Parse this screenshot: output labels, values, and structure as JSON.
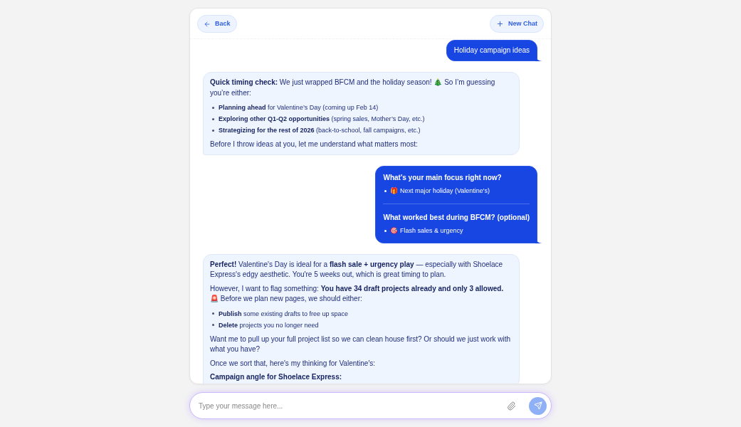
{
  "header": {
    "back_label": "Back",
    "new_chat_label": "New Chat"
  },
  "messages": [
    {
      "kind": "prompt",
      "text": "Holiday campaign ideas"
    },
    {
      "kind": "reply",
      "blocks": [
        {
          "kind": "paragraph",
          "text": "**Quick timing check:** We just wrapped BFCM and the holiday season! 🎄 So I’m guessing you’re either:"
        },
        {
          "kind": "list",
          "items": [
            "**Planning ahead** for Valentine’s Day (coming up Feb 14)",
            "**Exploring other Q1-Q2 opportunities** (spring sales, Mother’s Day, etc.)",
            "**Strategizing for the rest of 2026** (back-to-school, fall campaigns, etc.)"
          ]
        },
        {
          "kind": "paragraph",
          "text": "Before I throw ideas at you, let me understand what matters most:"
        }
      ]
    },
    {
      "kind": "answers",
      "answers": [
        {
          "question": "What's your main focus right now?",
          "choices": [
            "🎁 Next major holiday (Valentine's)"
          ]
        },
        {
          "question": "What worked best during BFCM? (optional)",
          "choices": [
            "🎯 Flash sales & urgency"
          ]
        }
      ]
    },
    {
      "kind": "reply",
      "blocks": [
        {
          "kind": "paragraph",
          "text": "**Perfect!** Valentine's Day is ideal for a **flash sale + urgency play** — especially with Shoelace Express's edgy aesthetic. You're 5 weeks out, which is great timing to plan."
        },
        {
          "kind": "paragraph",
          "text": "However, I want to flag something: **You have 34 draft projects already and only 3 allowed.** 🚨 Before we plan new pages, we should either:"
        },
        {
          "kind": "list",
          "items": [
            "**Publish** some existing drafts to free up space",
            "**Delete** projects you no longer need"
          ]
        },
        {
          "kind": "paragraph",
          "text": "Want me to pull up your full project list so we can clean house first? Or should we just work with what you have?"
        },
        {
          "kind": "paragraph",
          "text": "Once we sort that, here's my thinking for Valentine's:"
        },
        {
          "kind": "heading",
          "text": "Campaign angle for Shoelace Express:"
        }
      ]
    }
  ],
  "composer": {
    "placeholder": "Type your message here..."
  }
}
